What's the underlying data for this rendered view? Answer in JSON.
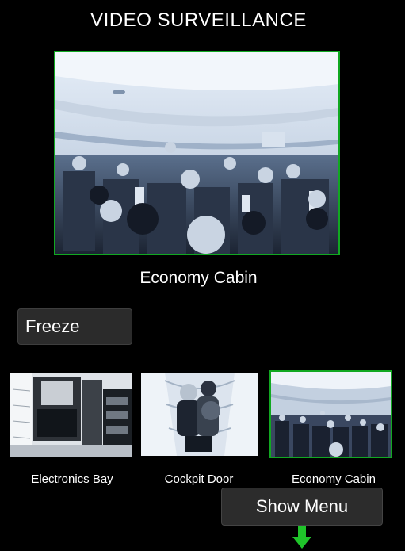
{
  "header": {
    "title": "VIDEO SURVEILLANCE"
  },
  "main_view": {
    "caption": "Economy Cabin"
  },
  "controls": {
    "freeze_label": "Freeze",
    "show_menu_label": "Show Menu"
  },
  "cameras": [
    {
      "label": "Electronics Bay",
      "selected": false
    },
    {
      "label": "Cockpit Door",
      "selected": false
    },
    {
      "label": "Economy Cabin",
      "selected": true
    }
  ],
  "colors": {
    "selection_border": "#11a821",
    "arrow": "#1fc42a"
  },
  "icons": {
    "menu_arrow": "down-arrow-icon"
  }
}
